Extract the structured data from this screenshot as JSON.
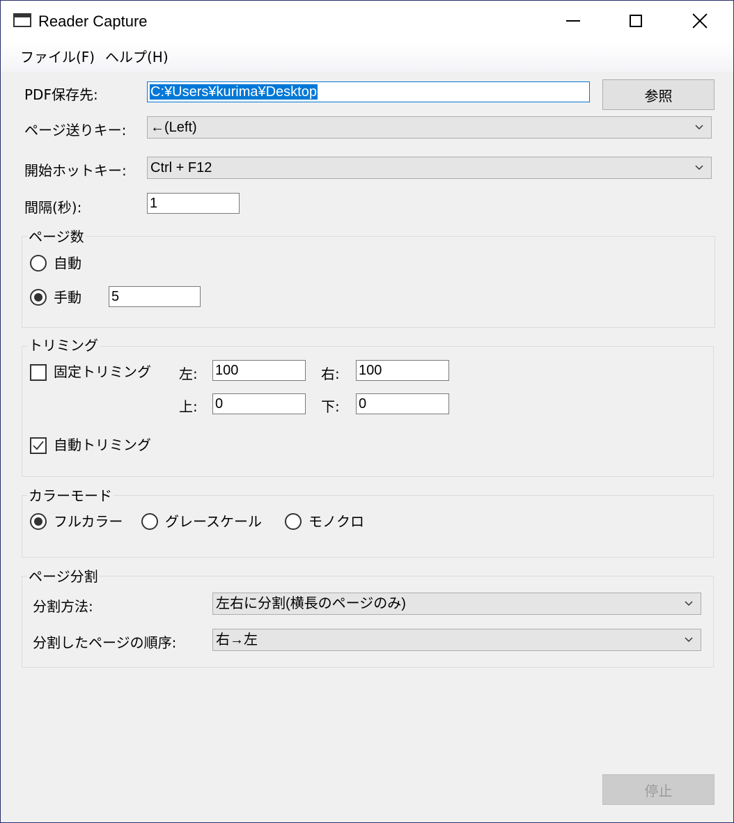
{
  "window": {
    "title": "Reader Capture"
  },
  "menu": {
    "file": "ファイル(F)",
    "help": "ヘルプ(H)"
  },
  "pdf": {
    "label": "PDF保存先:",
    "path": "C:¥Users¥kurima¥Desktop",
    "browse": "参照"
  },
  "page_turn": {
    "label": "ページ送りキー:",
    "value": "←(Left)"
  },
  "hotkey": {
    "label": "開始ホットキー:",
    "value": "Ctrl + F12"
  },
  "interval": {
    "label": "間隔(秒):",
    "value": "1"
  },
  "pages": {
    "title": "ページ数",
    "auto": "自動",
    "manual": "手動",
    "manual_value": "5",
    "selected": "manual"
  },
  "trimming": {
    "title": "トリミング",
    "fixed": "固定トリミング",
    "fixed_checked": false,
    "left_label": "左:",
    "left": "100",
    "right_label": "右:",
    "right": "100",
    "top_label": "上:",
    "top": "0",
    "bottom_label": "下:",
    "bottom": "0",
    "auto": "自動トリミング",
    "auto_checked": true
  },
  "color_mode": {
    "title": "カラーモード",
    "full": "フルカラー",
    "gray": "グレースケール",
    "mono": "モノクロ",
    "selected": "full"
  },
  "split": {
    "title": "ページ分割",
    "method_label": "分割方法:",
    "method": "左右に分割(横長のページのみ)",
    "order_label": "分割したページの順序:",
    "order": "右→左"
  },
  "stop_button": "停止"
}
